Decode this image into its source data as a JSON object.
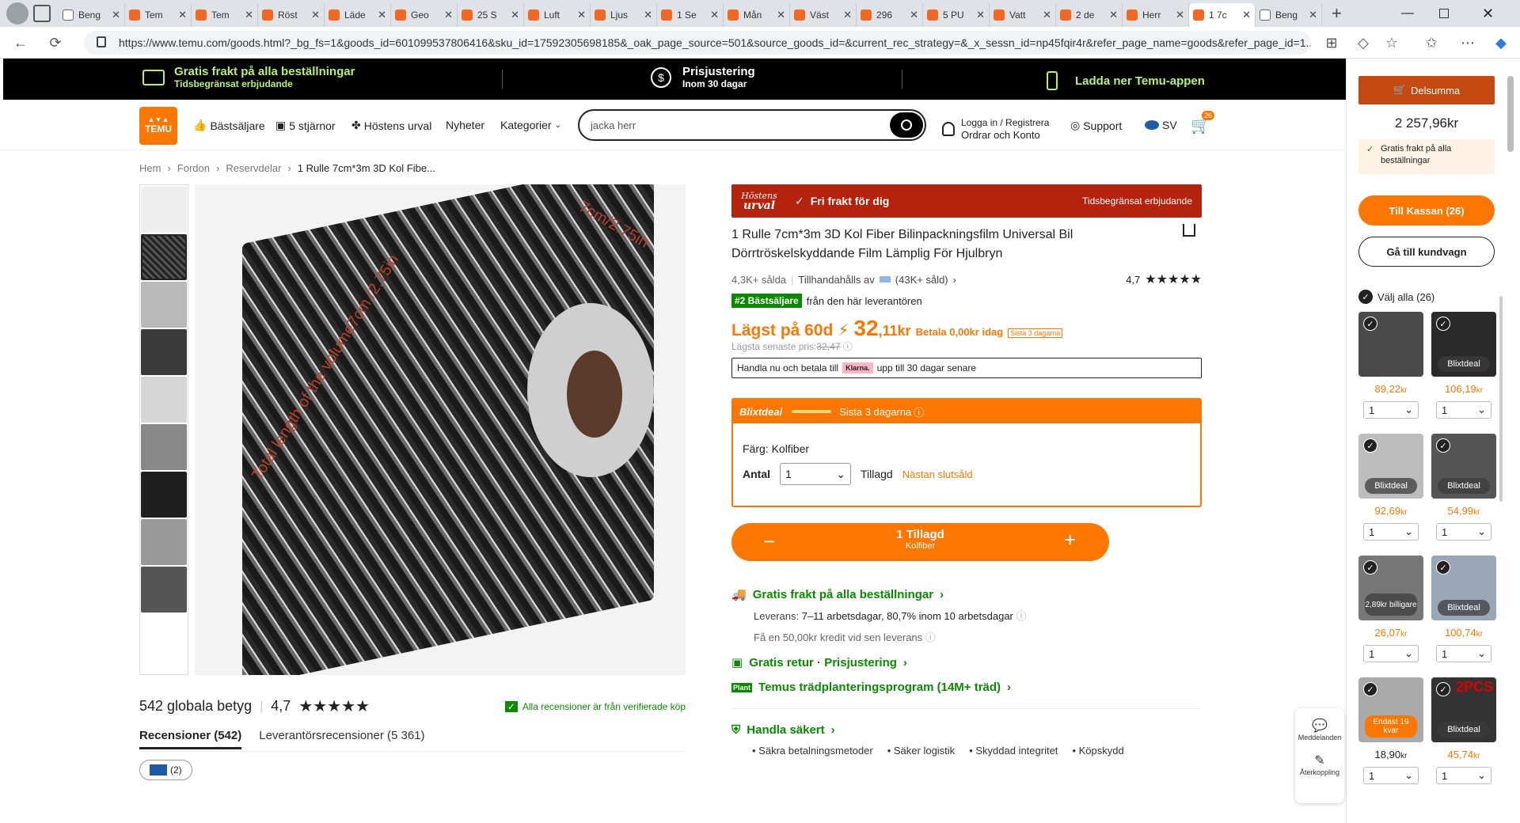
{
  "browser": {
    "tabs": [
      "Beng",
      "Tem",
      "Tem",
      "Röst",
      "Läde",
      "Geo",
      "25 S",
      "Luft",
      "Ljus",
      "1 Se",
      "Mån",
      "Väst",
      "296",
      "5 PU",
      "Vatt",
      "2 de",
      "Herr",
      "1 7c",
      "Beng"
    ],
    "url": "https://www.temu.com/goods.html?_bg_fs=1&goods_id=601099537806416&sku_id=17592305698185&_oak_page_source=501&source_goods_id=&current_rec_strategy=&_x_sessn_id=np45fqir4r&refer_page_name=goods&refer_page_id=1..."
  },
  "promo": {
    "ship_title": "Gratis frakt på alla beställningar",
    "ship_sub": "Tidsbegränsat erbjudande",
    "price_title": "Prisjustering",
    "price_sub": "Inom 30 dagar",
    "app": "Ladda ner Temu-appen"
  },
  "header": {
    "logo": "TEMU",
    "nav": [
      "Bästsäljare",
      "5 stjärnor",
      "Höstens urval",
      "Nyheter",
      "Kategorier"
    ],
    "search_placeholder": "jacka herr",
    "login_l1": "Logga in / Registrera",
    "login_l2": "Ordrar och Konto",
    "support": "Support",
    "lang": "SV",
    "cart_count": "26"
  },
  "breadcrumb": [
    "Hem",
    "Fordon",
    "Reservdelar",
    "1 Rulle 7cm*3m 3D Kol Fibe..."
  ],
  "image": {
    "dim_top": "7cm/2.75in",
    "dim_side": "Total length of the volume7cm /2.75in"
  },
  "product": {
    "banner_logo_1": "Höstens",
    "banner_logo_2": "urval",
    "banner_free": "Fri frakt för dig",
    "banner_limited": "Tidsbegränsat erbjudande",
    "title": "1 Rulle 7cm*3m 3D Kol Fiber Bilinpackningsfilm Universal Bil Dörrtröskelskyddande Film Lämplig För Hjulbryn",
    "sold": "4,3K+ sålda",
    "provided_by": "Tillhandahålls av",
    "seller_sold": "(43K+ såld)",
    "rating": "4,7",
    "best_badge": "#2 Bästsäljare",
    "best_text": "från den här leverantören",
    "lowest_label": "Lägst på 60d",
    "price_main": "32",
    "price_dec": ",11kr",
    "pay_today": "Betala 0,00kr idag",
    "last_days": "Sista 3 dagarna",
    "lowest_recent_label": "Lägsta senaste pris:",
    "lowest_recent": "32,47",
    "klarna_pre": "Handla nu och betala till",
    "klarna": "Klarna.",
    "klarna_post": "upp till 30 dagar senare",
    "flash_title": "Blixtdeal",
    "flash_days": "Sista 3 dagarna",
    "color_label": "Färg: Kolfiber",
    "qty_label": "Antal",
    "qty": "1",
    "added": "Tillagd",
    "almost_sold": "Nästan slutsåld",
    "btn_main": "1 Tillagd",
    "btn_sub": "Kolfiber",
    "free_ship": "Gratis frakt på alla beställningar",
    "delivery_label": "Leverans:",
    "delivery": "7–11 arbetsdagar, 80,7% inom 10 arbetsdagar",
    "credit": "Få en 50,00kr kredit vid sen leverans",
    "free_return": "Gratis retur · Prisjustering",
    "tree": "Temus trädplanteringsprogram (14M+ träd)",
    "safe": "Handla säkert",
    "safe_items": [
      "Säkra betalningsmetoder",
      "Säker logistik",
      "Skyddad integritet",
      "Köpskydd"
    ]
  },
  "reviews": {
    "count": "542 globala betyg",
    "rating": "4,7",
    "verified": "Alla recensioner är från verifierade köp",
    "tab1": "Recensioner (542)",
    "tab2": "Leverantörsrecensioner (5 361)",
    "flag_count": "(2)"
  },
  "cart": {
    "title": "Delsumma",
    "total": "2 257,96kr",
    "free": "Gratis frakt på alla beställningar",
    "checkout": "Till Kassan (26)",
    "to_cart": "Gå till kundvagn",
    "select_all": "Välj alla (26)",
    "items": [
      {
        "price": "89,22",
        "qty": "1",
        "badge": ""
      },
      {
        "price": "106,19",
        "qty": "1",
        "badge": "Blixtdeal"
      },
      {
        "price": "92,69",
        "qty": "1",
        "badge": "Blixtdeal"
      },
      {
        "price": "54,99",
        "qty": "1",
        "badge": "Blixtdeal"
      },
      {
        "price": "26,07",
        "qty": "1",
        "badge": "2,89kr billigare"
      },
      {
        "price": "100,74",
        "qty": "1",
        "badge": "Blixtdeal"
      },
      {
        "price": "18,90",
        "qty": "1",
        "badge": "Endast 19 kvar"
      },
      {
        "price": "45,74",
        "qty": "1",
        "badge": "Blixtdeal"
      }
    ],
    "item8_text": "2PCS",
    "currency": "kr"
  },
  "float": {
    "messages": "Meddelanden",
    "feedback": "Återkoppling"
  },
  "colors": {
    "accent": "#fb7701",
    "banner": "#b5220d",
    "green": "#0a8a00",
    "promo_green": "#b8f073"
  }
}
